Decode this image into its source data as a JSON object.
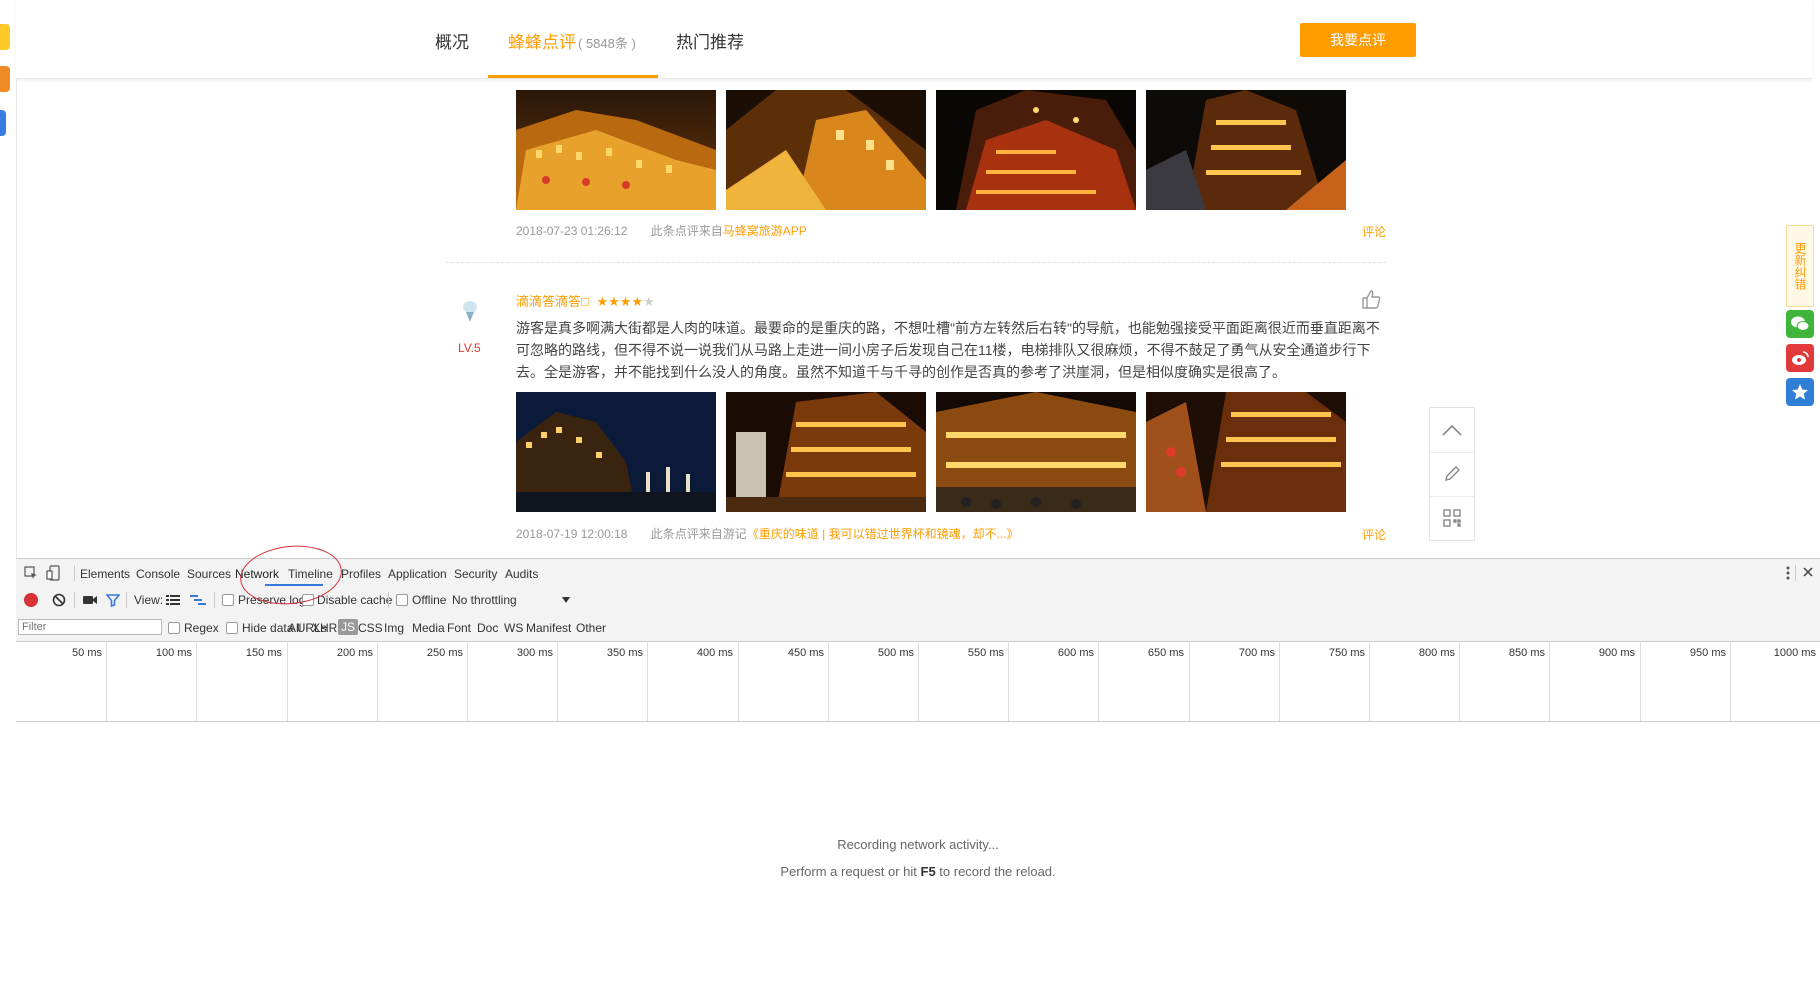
{
  "nav": {
    "tabs": [
      {
        "label": "概况"
      },
      {
        "label": "蜂蜂点评",
        "count": "( 5848条 )"
      },
      {
        "label": "热门推荐"
      }
    ],
    "review_button": "我要点评"
  },
  "reviews": [
    {
      "timestamp": "2018-07-23 01:26:12",
      "source_prefix": "此条点评来自",
      "source": "马蜂窝旅游APP",
      "comment_label": "评论"
    },
    {
      "username": "滴滴答滴答□",
      "stars": 4,
      "max_stars": 5,
      "level": "LV.5",
      "text": "游客是真多啊满大街都是人肉的味道。最要命的是重庆的路，不想吐槽\"前方左转然后右转\"的导航，也能勉强接受平面距离很近而垂直距离不可忽略的路线，但不得不说一说我们从马路上走进一间小房子后发现自己在11楼，电梯排队又很麻烦，不得不鼓足了勇气从安全通道步行下去。全是游客，并不能找到什么没人的角度。虽然不知道千与千寻的创作是否真的参考了洪崖洞，但是相似度确实是很高了。",
      "timestamp": "2018-07-19 12:00:18",
      "source_prefix": "此条点评来自游记",
      "source": "《重庆的味道 | 我可以错过世界杯和镜魂，却不...》",
      "comment_label": "评论"
    }
  ],
  "sidebar": {
    "feedback": "更新纠错"
  },
  "devtools": {
    "tabs": [
      "Elements",
      "Console",
      "Sources",
      "Network",
      "Timeline",
      "Profiles",
      "Application",
      "Security",
      "Audits"
    ],
    "active_tab": "Network",
    "toolbar": {
      "view_label": "View:",
      "preserve_log": "Preserve log",
      "disable_cache": "Disable cache",
      "offline": "Offline",
      "throttling": "No throttling"
    },
    "filter": {
      "placeholder": "Filter",
      "regex": "Regex",
      "hide_data_urls": "Hide data URLs",
      "types": [
        "All",
        "XHR",
        "JS",
        "CSS",
        "Img",
        "Media",
        "Font",
        "Doc",
        "WS",
        "Manifest",
        "Other"
      ],
      "active_type": "JS"
    },
    "timeline_ticks": [
      "50 ms",
      "100 ms",
      "150 ms",
      "200 ms",
      "250 ms",
      "300 ms",
      "350 ms",
      "400 ms",
      "450 ms",
      "500 ms",
      "550 ms",
      "600 ms",
      "650 ms",
      "700 ms",
      "750 ms",
      "800 ms",
      "850 ms",
      "900 ms",
      "950 ms",
      "1000 ms"
    ],
    "recording_message": "Recording network activity...",
    "recording_hint_pre": "Perform a request or hit ",
    "recording_hint_key": "F5",
    "recording_hint_post": " to record the reload."
  },
  "colors": {
    "accent": "#ff9d00",
    "devtools_blue": "#3879d9",
    "record_red": "#d9303a"
  }
}
